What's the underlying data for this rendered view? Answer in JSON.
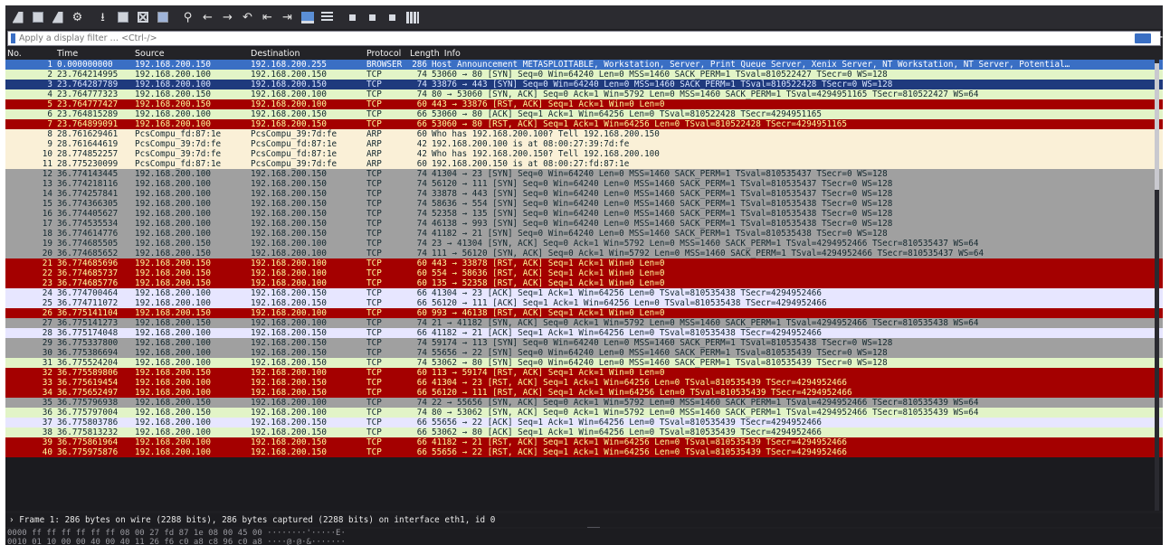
{
  "filter": {
    "placeholder": "Apply a display filter … <Ctrl-/>"
  },
  "columns": {
    "no": "No.",
    "time": "Time",
    "source": "Source",
    "destination": "Destination",
    "protocol": "Protocol",
    "length": "Length",
    "info": "Info"
  },
  "colors": {
    "selected": [
      "#3a6fc4",
      "#ffffff"
    ],
    "tcp_green": [
      "#e2f4c7",
      "#12272e"
    ],
    "tcp_gray": [
      "#a0a0a0",
      "#12272e"
    ],
    "rst_red": [
      "#a40000",
      "#fffc9c"
    ],
    "navy": [
      "#1f3a7d",
      "#d9e6ff"
    ],
    "arp_tan": [
      "#faf0d7",
      "#12272e"
    ],
    "lilac": [
      "#e7e6ff",
      "#12272e"
    ]
  },
  "packets": [
    {
      "no": "1",
      "time": "0.000000000",
      "src": "192.168.200.150",
      "dst": "192.168.200.255",
      "proto": "BROWSER",
      "len": "286",
      "info": "Host Announcement METASPLOITABLE, Workstation, Server, Print Queue Server, Xenix Server, NT Workstation, NT Server, Potential…",
      "color": "selected"
    },
    {
      "no": "2",
      "time": "23.764214995",
      "src": "192.168.200.100",
      "dst": "192.168.200.150",
      "proto": "TCP",
      "len": "74",
      "info": "53060 → 80 [SYN] Seq=0 Win=64240 Len=0 MSS=1460 SACK_PERM=1 TSval=810522427 TSecr=0 WS=128",
      "color": "tcp_green"
    },
    {
      "no": "3",
      "time": "23.764287789",
      "src": "192.168.200.100",
      "dst": "192.168.200.150",
      "proto": "TCP",
      "len": "74",
      "info": "33876 → 443 [SYN] Seq=0 Win=64240 Len=0 MSS=1460 SACK_PERM=1 TSval=810522428 TSecr=0 WS=128",
      "color": "navy"
    },
    {
      "no": "4",
      "time": "23.764777323",
      "src": "192.168.200.150",
      "dst": "192.168.200.100",
      "proto": "TCP",
      "len": "74",
      "info": "80 → 53060 [SYN, ACK] Seq=0 Ack=1 Win=5792 Len=0 MSS=1460 SACK_PERM=1 TSval=4294951165 TSecr=810522427 WS=64",
      "color": "tcp_green"
    },
    {
      "no": "5",
      "time": "23.764777427",
      "src": "192.168.200.150",
      "dst": "192.168.200.100",
      "proto": "TCP",
      "len": "60",
      "info": "443 → 33876 [RST, ACK] Seq=1 Ack=1 Win=0 Len=0",
      "color": "rst_red"
    },
    {
      "no": "6",
      "time": "23.764815289",
      "src": "192.168.200.100",
      "dst": "192.168.200.150",
      "proto": "TCP",
      "len": "66",
      "info": "53060 → 80 [ACK] Seq=1 Ack=1 Win=64256 Len=0 TSval=810522428 TSecr=4294951165",
      "color": "tcp_green"
    },
    {
      "no": "7",
      "time": "23.764899091",
      "src": "192.168.200.100",
      "dst": "192.168.200.150",
      "proto": "TCP",
      "len": "66",
      "info": "53060 → 80 [RST, ACK] Seq=1 Ack=1 Win=64256 Len=0 TSval=810522428 TSecr=4294951165",
      "color": "rst_red"
    },
    {
      "no": "8",
      "time": "28.761629461",
      "src": "PcsCompu_fd:87:1e",
      "dst": "PcsCompu_39:7d:fe",
      "proto": "ARP",
      "len": "60",
      "info": "Who has 192.168.200.100? Tell 192.168.200.150",
      "color": "arp_tan"
    },
    {
      "no": "9",
      "time": "28.761644619",
      "src": "PcsCompu_39:7d:fe",
      "dst": "PcsCompu_fd:87:1e",
      "proto": "ARP",
      "len": "42",
      "info": "192.168.200.100 is at 08:00:27:39:7d:fe",
      "color": "arp_tan"
    },
    {
      "no": "10",
      "time": "28.774852257",
      "src": "PcsCompu_39:7d:fe",
      "dst": "PcsCompu_fd:87:1e",
      "proto": "ARP",
      "len": "42",
      "info": "Who has 192.168.200.150? Tell 192.168.200.100",
      "color": "arp_tan"
    },
    {
      "no": "11",
      "time": "28.775230099",
      "src": "PcsCompu_fd:87:1e",
      "dst": "PcsCompu_39:7d:fe",
      "proto": "ARP",
      "len": "60",
      "info": "192.168.200.150 is at 08:00:27:fd:87:1e",
      "color": "arp_tan"
    },
    {
      "no": "12",
      "time": "36.774143445",
      "src": "192.168.200.100",
      "dst": "192.168.200.150",
      "proto": "TCP",
      "len": "74",
      "info": "41304 → 23 [SYN] Seq=0 Win=64240 Len=0 MSS=1460 SACK_PERM=1 TSval=810535437 TSecr=0 WS=128",
      "color": "tcp_gray"
    },
    {
      "no": "13",
      "time": "36.774218116",
      "src": "192.168.200.100",
      "dst": "192.168.200.150",
      "proto": "TCP",
      "len": "74",
      "info": "56120 → 111 [SYN] Seq=0 Win=64240 Len=0 MSS=1460 SACK_PERM=1 TSval=810535437 TSecr=0 WS=128",
      "color": "tcp_gray"
    },
    {
      "no": "14",
      "time": "36.774257841",
      "src": "192.168.200.100",
      "dst": "192.168.200.150",
      "proto": "TCP",
      "len": "74",
      "info": "33878 → 443 [SYN] Seq=0 Win=64240 Len=0 MSS=1460 SACK_PERM=1 TSval=810535437 TSecr=0 WS=128",
      "color": "tcp_gray"
    },
    {
      "no": "15",
      "time": "36.774366305",
      "src": "192.168.200.100",
      "dst": "192.168.200.150",
      "proto": "TCP",
      "len": "74",
      "info": "58636 → 554 [SYN] Seq=0 Win=64240 Len=0 MSS=1460 SACK_PERM=1 TSval=810535438 TSecr=0 WS=128",
      "color": "tcp_gray"
    },
    {
      "no": "16",
      "time": "36.774405627",
      "src": "192.168.200.100",
      "dst": "192.168.200.150",
      "proto": "TCP",
      "len": "74",
      "info": "52358 → 135 [SYN] Seq=0 Win=64240 Len=0 MSS=1460 SACK_PERM=1 TSval=810535438 TSecr=0 WS=128",
      "color": "tcp_gray"
    },
    {
      "no": "17",
      "time": "36.774535534",
      "src": "192.168.200.100",
      "dst": "192.168.200.150",
      "proto": "TCP",
      "len": "74",
      "info": "46138 → 993 [SYN] Seq=0 Win=64240 Len=0 MSS=1460 SACK_PERM=1 TSval=810535438 TSecr=0 WS=128",
      "color": "tcp_gray"
    },
    {
      "no": "18",
      "time": "36.774614776",
      "src": "192.168.200.100",
      "dst": "192.168.200.150",
      "proto": "TCP",
      "len": "74",
      "info": "41182 → 21 [SYN] Seq=0 Win=64240 Len=0 MSS=1460 SACK_PERM=1 TSval=810535438 TSecr=0 WS=128",
      "color": "tcp_gray"
    },
    {
      "no": "19",
      "time": "36.774685505",
      "src": "192.168.200.150",
      "dst": "192.168.200.100",
      "proto": "TCP",
      "len": "74",
      "info": "23 → 41304 [SYN, ACK] Seq=0 Ack=1 Win=5792 Len=0 MSS=1460 SACK_PERM=1 TSval=4294952466 TSecr=810535437 WS=64",
      "color": "tcp_gray"
    },
    {
      "no": "20",
      "time": "36.774685652",
      "src": "192.168.200.150",
      "dst": "192.168.200.100",
      "proto": "TCP",
      "len": "74",
      "info": "111 → 56120 [SYN, ACK] Seq=0 Ack=1 Win=5792 Len=0 MSS=1460 SACK_PERM=1 TSval=4294952466 TSecr=810535437 WS=64",
      "color": "tcp_gray"
    },
    {
      "no": "21",
      "time": "36.774685696",
      "src": "192.168.200.150",
      "dst": "192.168.200.100",
      "proto": "TCP",
      "len": "60",
      "info": "443 → 33878 [RST, ACK] Seq=1 Ack=1 Win=0 Len=0",
      "color": "rst_red"
    },
    {
      "no": "22",
      "time": "36.774685737",
      "src": "192.168.200.150",
      "dst": "192.168.200.100",
      "proto": "TCP",
      "len": "60",
      "info": "554 → 58636 [RST, ACK] Seq=1 Ack=1 Win=0 Len=0",
      "color": "rst_red"
    },
    {
      "no": "23",
      "time": "36.774685776",
      "src": "192.168.200.150",
      "dst": "192.168.200.100",
      "proto": "TCP",
      "len": "60",
      "info": "135 → 52358 [RST, ACK] Seq=1 Ack=1 Win=0 Len=0",
      "color": "rst_red"
    },
    {
      "no": "24",
      "time": "36.774700464",
      "src": "192.168.200.100",
      "dst": "192.168.200.150",
      "proto": "TCP",
      "len": "66",
      "info": "41304 → 23 [ACK] Seq=1 Ack=1 Win=64256 Len=0 TSval=810535438 TSecr=4294952466",
      "color": "lilac"
    },
    {
      "no": "25",
      "time": "36.774711072",
      "src": "192.168.200.100",
      "dst": "192.168.200.150",
      "proto": "TCP",
      "len": "66",
      "info": "56120 → 111 [ACK] Seq=1 Ack=1 Win=64256 Len=0 TSval=810535438 TSecr=4294952466",
      "color": "lilac"
    },
    {
      "no": "26",
      "time": "36.775141104",
      "src": "192.168.200.150",
      "dst": "192.168.200.100",
      "proto": "TCP",
      "len": "60",
      "info": "993 → 46138 [RST, ACK] Seq=1 Ack=1 Win=0 Len=0",
      "color": "rst_red"
    },
    {
      "no": "27",
      "time": "36.775141273",
      "src": "192.168.200.150",
      "dst": "192.168.200.100",
      "proto": "TCP",
      "len": "74",
      "info": "21 → 41182 [SYN, ACK] Seq=0 Ack=1 Win=5792 Len=0 MSS=1460 SACK_PERM=1 TSval=4294952466 TSecr=810535438 WS=64",
      "color": "tcp_gray"
    },
    {
      "no": "28",
      "time": "36.775174048",
      "src": "192.168.200.100",
      "dst": "192.168.200.150",
      "proto": "TCP",
      "len": "66",
      "info": "41182 → 21 [ACK] Seq=1 Ack=1 Win=64256 Len=0 TSval=810535438 TSecr=4294952466",
      "color": "lilac"
    },
    {
      "no": "29",
      "time": "36.775337800",
      "src": "192.168.200.100",
      "dst": "192.168.200.150",
      "proto": "TCP",
      "len": "74",
      "info": "59174 → 113 [SYN] Seq=0 Win=64240 Len=0 MSS=1460 SACK_PERM=1 TSval=810535438 TSecr=0 WS=128",
      "color": "tcp_gray"
    },
    {
      "no": "30",
      "time": "36.775386694",
      "src": "192.168.200.100",
      "dst": "192.168.200.150",
      "proto": "TCP",
      "len": "74",
      "info": "55656 → 22 [SYN] Seq=0 Win=64240 Len=0 MSS=1460 SACK_PERM=1 TSval=810535439 TSecr=0 WS=128",
      "color": "tcp_gray"
    },
    {
      "no": "31",
      "time": "36.775524204",
      "src": "192.168.200.100",
      "dst": "192.168.200.150",
      "proto": "TCP",
      "len": "74",
      "info": "53062 → 80 [SYN] Seq=0 Win=64240 Len=0 MSS=1460 SACK_PERM=1 TSval=810535439 TSecr=0 WS=128",
      "color": "tcp_green"
    },
    {
      "no": "32",
      "time": "36.775589806",
      "src": "192.168.200.150",
      "dst": "192.168.200.100",
      "proto": "TCP",
      "len": "60",
      "info": "113 → 59174 [RST, ACK] Seq=1 Ack=1 Win=0 Len=0",
      "color": "rst_red"
    },
    {
      "no": "33",
      "time": "36.775619454",
      "src": "192.168.200.100",
      "dst": "192.168.200.150",
      "proto": "TCP",
      "len": "66",
      "info": "41304 → 23 [RST, ACK] Seq=1 Ack=1 Win=64256 Len=0 TSval=810535439 TSecr=4294952466",
      "color": "rst_red"
    },
    {
      "no": "34",
      "time": "36.775652497",
      "src": "192.168.200.100",
      "dst": "192.168.200.150",
      "proto": "TCP",
      "len": "66",
      "info": "56120 → 111 [RST, ACK] Seq=1 Ack=1 Win=64256 Len=0 TSval=810535439 TSecr=4294952466",
      "color": "rst_red"
    },
    {
      "no": "35",
      "time": "36.775796938",
      "src": "192.168.200.150",
      "dst": "192.168.200.100",
      "proto": "TCP",
      "len": "74",
      "info": "22 → 55656 [SYN, ACK] Seq=0 Ack=1 Win=5792 Len=0 MSS=1460 SACK_PERM=1 TSval=4294952466 TSecr=810535439 WS=64",
      "color": "tcp_gray"
    },
    {
      "no": "36",
      "time": "36.775797004",
      "src": "192.168.200.150",
      "dst": "192.168.200.100",
      "proto": "TCP",
      "len": "74",
      "info": "80 → 53062 [SYN, ACK] Seq=0 Ack=1 Win=5792 Len=0 MSS=1460 SACK_PERM=1 TSval=4294952466 TSecr=810535439 WS=64",
      "color": "tcp_green"
    },
    {
      "no": "37",
      "time": "36.775803786",
      "src": "192.168.200.100",
      "dst": "192.168.200.150",
      "proto": "TCP",
      "len": "66",
      "info": "55656 → 22 [ACK] Seq=1 Ack=1 Win=64256 Len=0 TSval=810535439 TSecr=4294952466",
      "color": "lilac"
    },
    {
      "no": "38",
      "time": "36.775813232",
      "src": "192.168.200.100",
      "dst": "192.168.200.150",
      "proto": "TCP",
      "len": "66",
      "info": "53062 → 80 [ACK] Seq=1 Ack=1 Win=64256 Len=0 TSval=810535439 TSecr=4294952466",
      "color": "tcp_green"
    },
    {
      "no": "39",
      "time": "36.775861964",
      "src": "192.168.200.100",
      "dst": "192.168.200.150",
      "proto": "TCP",
      "len": "66",
      "info": "41182 → 21 [RST, ACK] Seq=1 Ack=1 Win=64256 Len=0 TSval=810535439 TSecr=4294952466",
      "color": "rst_red"
    },
    {
      "no": "40",
      "time": "36.775975876",
      "src": "192.168.200.100",
      "dst": "192.168.200.150",
      "proto": "TCP",
      "len": "66",
      "info": "55656 → 22 [RST, ACK] Seq=1 Ack=1 Win=64256 Len=0 TSval=810535439 TSecr=4294952466",
      "color": "rst_red"
    }
  ],
  "details": {
    "frame": "› Frame 1: 286 bytes on wire (2288 bits), 286 bytes captured (2288 bits) on interface eth1, id 0"
  },
  "bytes": {
    "line1": "0000  ff ff ff ff ff ff 08 00  27 fd 87 1e 08 00 45 00   ········'·····E·",
    "line2": "0010  01 10 00 00 40 00 40 11  26 f6 c0 a8 c8 96 c0 a8   ····@·@·&·······"
  }
}
